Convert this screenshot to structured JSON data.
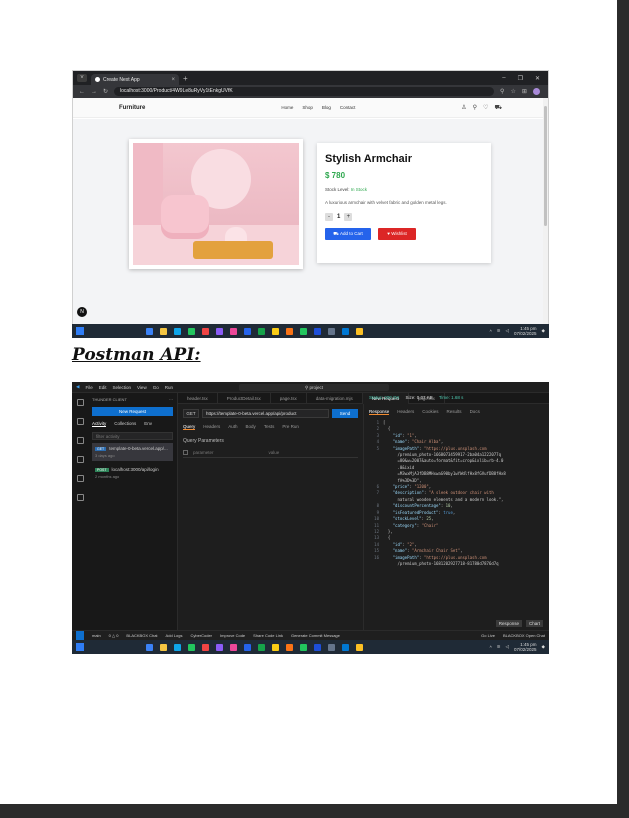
{
  "browser": {
    "tab_title": "Create Next App",
    "url": "localhost:3000/Product/4W9Le8uRyVy1tEnkgUVfK",
    "site": {
      "brand": "Furniture",
      "menu": [
        "Home",
        "Shop",
        "Blog",
        "Contact"
      ]
    },
    "product": {
      "title": "Stylish Armchair",
      "price": "$ 780",
      "stock_label": "Stock Level:",
      "stock_value": "In Stock",
      "description": "A luxurious armchair with velvet fabric and golden metal legs.",
      "qty_minus": "-",
      "qty": "1",
      "qty_plus": "+",
      "add_to_cart": "Add to Cart",
      "wishlist": "Wishlist"
    }
  },
  "taskbar": {
    "time": "1:45 pm",
    "date": "07/02/2025"
  },
  "heading": "Postman API:",
  "postman": {
    "search": "project",
    "sidebar": {
      "header": "THUNDER CLIENT",
      "new_request": "New Request",
      "tabs": [
        "Activity",
        "Collections",
        "Env"
      ],
      "filter_placeholder": "filter activity",
      "history": [
        {
          "method": "GET",
          "url": "template-0-beta.vercel.app/...",
          "when": "3 days ago"
        },
        {
          "method": "POST",
          "url": "localhost:3000/api/login",
          "when": "2 months ago"
        }
      ]
    },
    "editor_tabs": [
      "header.tsx",
      "ProductDetail.tsx",
      "page.tsx",
      "data-migration.mjs",
      "New Request",
      "page.tsx"
    ],
    "request": {
      "method": "GET",
      "url": "https://template-0-beta.vercel.app/api/product",
      "send": "Send",
      "tabs": [
        "Query",
        "Headers",
        "Auth",
        "Body",
        "Tests",
        "Pre Run"
      ],
      "query_title": "Query Parameters",
      "param_placeholder": "parameter",
      "value_placeholder": "value"
    },
    "response": {
      "tabs": [
        "Response",
        "Headers",
        "Cookies",
        "Results",
        "Docs"
      ],
      "status": "Status: 200 OK",
      "size": "Size: 0.07 KB",
      "time": "Time: 1.68 s",
      "lines": [
        {
          "n": "1",
          "t": "["
        },
        {
          "n": "2",
          "t": "  {"
        },
        {
          "n": "3",
          "t": "    \"id\": \"1\","
        },
        {
          "n": "4",
          "t": "    \"name\": \"Chair Alba\","
        },
        {
          "n": "5",
          "t": "    \"imagePath\": \"https://plus.unsplash.com"
        },
        {
          "n": "",
          "t": "      /premium_photo-1668073459917-2ba04a1222077q"
        },
        {
          "n": "",
          "t": "      =80&w=2007&auto=format&fit=crop&ixlib=rb-4.0"
        },
        {
          "n": "",
          "t": "      .0&ixid"
        },
        {
          "n": "",
          "t": "      =M3wxMjA3fDB8MHxwaG90by1wYWdlfHx8fGVufDB8fHx8"
        },
        {
          "n": "",
          "t": "      fA%3D%3D\","
        },
        {
          "n": "6",
          "t": "    \"price\": \"1200\","
        },
        {
          "n": "7",
          "t": "    \"description\": \"A sleek outdoor chair with"
        },
        {
          "n": "",
          "t": "      natural wooden elements and a modern look.\","
        },
        {
          "n": "8",
          "t": "    \"discountPercentage\": 10,"
        },
        {
          "n": "9",
          "t": "    \"isFeaturedProduct\": true,"
        },
        {
          "n": "10",
          "t": "    \"stockLevel\": 25,"
        },
        {
          "n": "11",
          "t": "    \"category\": \"Chair\""
        },
        {
          "n": "12",
          "t": "  },"
        },
        {
          "n": "13",
          "t": "  {"
        },
        {
          "n": "14",
          "t": "    \"id\": \"2\","
        },
        {
          "n": "15",
          "t": "    \"name\": \"Armchair Chair Set\","
        },
        {
          "n": "16",
          "t": "    \"imagePath\": \"https://plus.unsplash.com"
        },
        {
          "n": "",
          "t": "      /premium_photo-1681202927718-81780d7876d7q"
        }
      ],
      "footer": [
        "Response",
        "Chart"
      ]
    },
    "statusbar": [
      "main",
      "0 △ 0",
      "BLACKBOX Chat",
      "Add Logs",
      "CyberCoder",
      "Improve Code",
      "Share Code Link",
      "Generate Commit Message",
      "Go Live",
      "BLACKBOX Open Chat"
    ]
  }
}
